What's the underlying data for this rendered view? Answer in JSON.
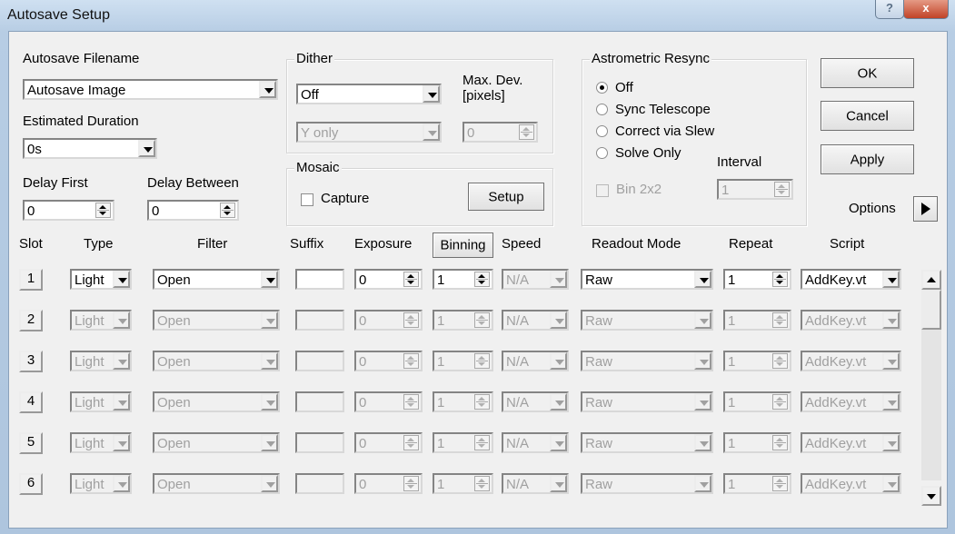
{
  "window": {
    "title": "Autosave Setup",
    "help_label": "?",
    "close_label": "x"
  },
  "autosave_filename": {
    "label": "Autosave Filename",
    "value": "Autosave Image"
  },
  "estimated_duration": {
    "label": "Estimated Duration",
    "value": "0s"
  },
  "delay_first": {
    "label": "Delay First",
    "value": "0"
  },
  "delay_between": {
    "label": "Delay Between",
    "value": "0"
  },
  "dither": {
    "legend": "Dither",
    "mode": "Off",
    "axis": "Y only",
    "max_dev_label": "Max. Dev.\n[pixels]",
    "max_dev_value": "0"
  },
  "mosaic": {
    "legend": "Mosaic",
    "capture_label": "Capture",
    "setup_label": "Setup"
  },
  "astrometric": {
    "legend": "Astrometric Resync",
    "options": [
      "Off",
      "Sync Telescope",
      "Correct via Slew",
      "Solve Only"
    ],
    "selected": "Off",
    "interval_label": "Interval",
    "interval_value": "1",
    "bin_label": "Bin 2x2"
  },
  "buttons": {
    "ok": "OK",
    "cancel": "Cancel",
    "apply": "Apply",
    "options": "Options"
  },
  "columns": {
    "slot": "Slot",
    "type": "Type",
    "filter": "Filter",
    "suffix": "Suffix",
    "exposure": "Exposure",
    "binning": "Binning",
    "speed": "Speed",
    "readout": "Readout Mode",
    "repeat": "Repeat",
    "script": "Script"
  },
  "rows": [
    {
      "slot": "1",
      "type": "Light",
      "filter": "Open",
      "suffix": "",
      "exposure": "0",
      "binning": "1",
      "speed": "N/A",
      "readout": "Raw",
      "repeat": "1",
      "script": "AddKey.vt"
    },
    {
      "slot": "2",
      "type": "Light",
      "filter": "Open",
      "suffix": "",
      "exposure": "0",
      "binning": "1",
      "speed": "N/A",
      "readout": "Raw",
      "repeat": "1",
      "script": "AddKey.vt"
    },
    {
      "slot": "3",
      "type": "Light",
      "filter": "Open",
      "suffix": "",
      "exposure": "0",
      "binning": "1",
      "speed": "N/A",
      "readout": "Raw",
      "repeat": "1",
      "script": "AddKey.vt"
    },
    {
      "slot": "4",
      "type": "Light",
      "filter": "Open",
      "suffix": "",
      "exposure": "0",
      "binning": "1",
      "speed": "N/A",
      "readout": "Raw",
      "repeat": "1",
      "script": "AddKey.vt"
    },
    {
      "slot": "5",
      "type": "Light",
      "filter": "Open",
      "suffix": "",
      "exposure": "0",
      "binning": "1",
      "speed": "N/A",
      "readout": "Raw",
      "repeat": "1",
      "script": "AddKey.vt"
    },
    {
      "slot": "6",
      "type": "Light",
      "filter": "Open",
      "suffix": "",
      "exposure": "0",
      "binning": "1",
      "speed": "N/A",
      "readout": "Raw",
      "repeat": "1",
      "script": "AddKey.vt"
    }
  ]
}
